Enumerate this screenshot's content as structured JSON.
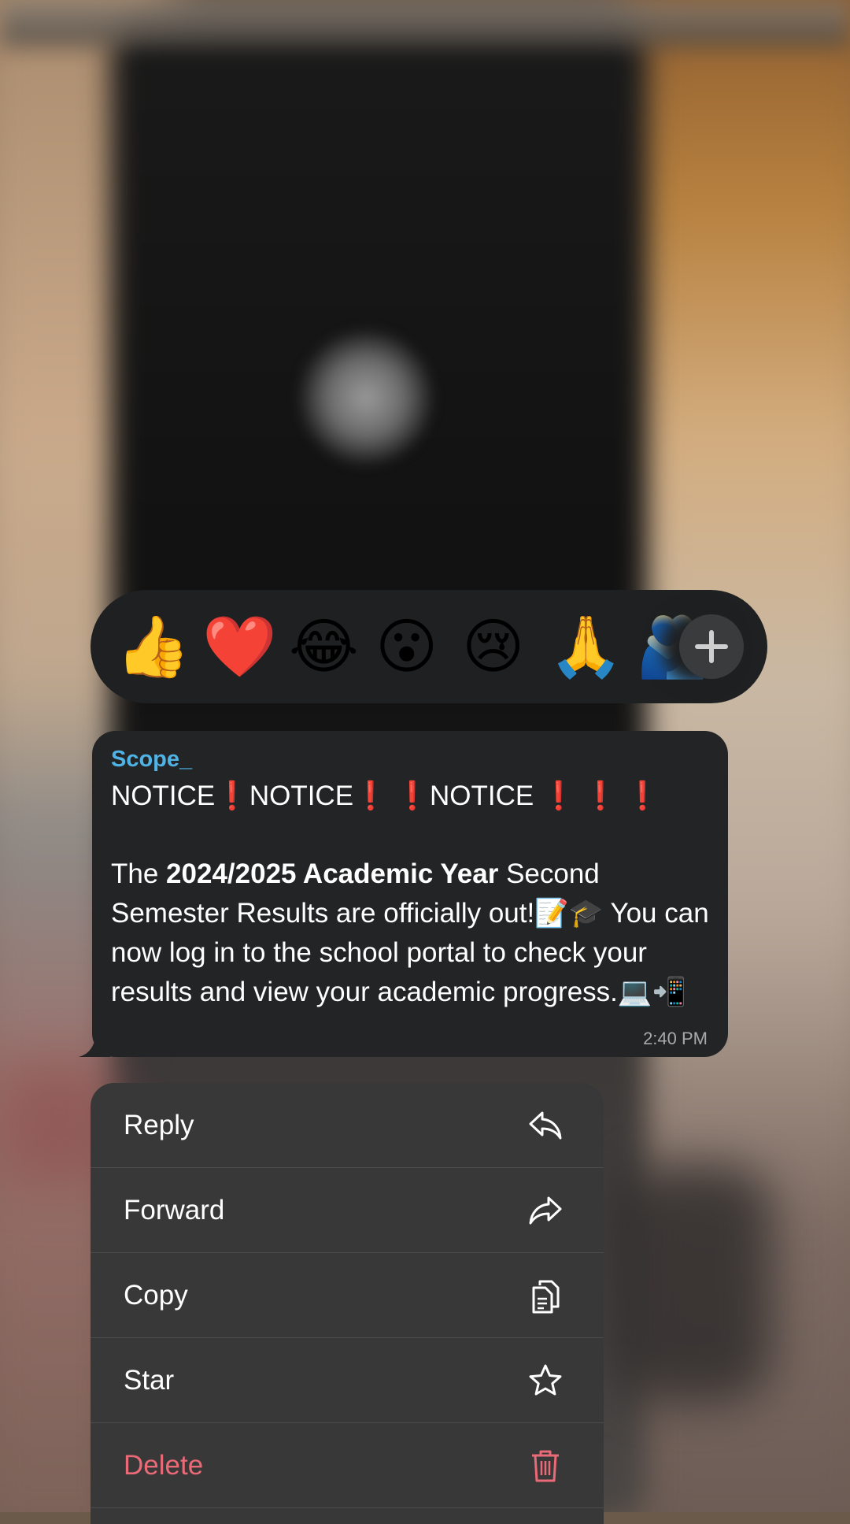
{
  "reactions": {
    "emojis": [
      "👍",
      "❤️",
      "😂",
      "😮",
      "😢",
      "🙏",
      "🫂"
    ],
    "plus_icon": "plus-icon"
  },
  "message": {
    "sender": "Scope_",
    "notice_word": "NOTICE",
    "excl": "❗",
    "intro": "The ",
    "bold": "2024/2025 Academic Year",
    "rest": " Second Semester Results are officially out!📝🎓 You can now log in to the school portal to check your results and view your academic progress.💻📲",
    "time": "2:40 PM"
  },
  "menu": {
    "reply": "Reply",
    "forward": "Forward",
    "copy": "Copy",
    "star": "Star",
    "delete": "Delete"
  },
  "colors": {
    "sender": "#4fb3e6",
    "delete": "#ea6a77",
    "bubble": "#232425",
    "menu": "#383838"
  }
}
